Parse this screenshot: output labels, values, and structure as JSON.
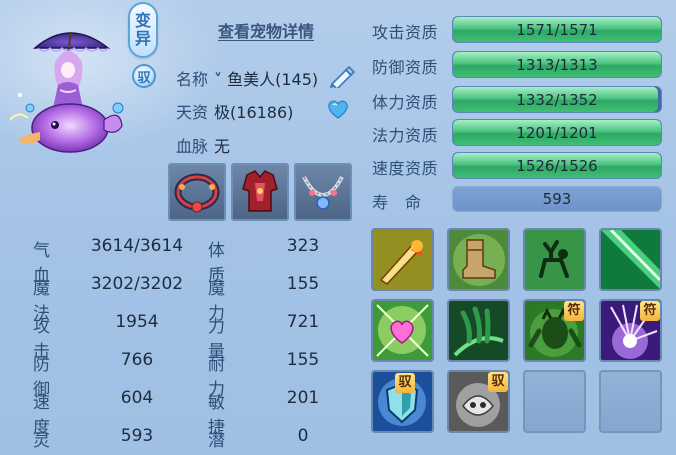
{
  "header": {
    "badge_top": "变",
    "badge_bottom": "异",
    "ride_badge": "驭",
    "detail_link": "查看宠物详情"
  },
  "pet": {
    "name_label": "名称",
    "name_value": "˅ 鱼美人(145)",
    "talent_label": "天资",
    "talent_value": "极(16186)",
    "blood_label": "血脉",
    "blood_value": "无"
  },
  "equipment": [
    {
      "name": "red-necklace"
    },
    {
      "name": "red-armor"
    },
    {
      "name": "silver-necklace"
    }
  ],
  "attributes": {
    "left": [
      {
        "label": "气血",
        "value": "3614/3614"
      },
      {
        "label": "魔法",
        "value": "3202/3202"
      },
      {
        "label": "攻击",
        "value": "1954"
      },
      {
        "label": "防御",
        "value": "766"
      },
      {
        "label": "速度",
        "value": "604"
      },
      {
        "label": "灵力",
        "value": "593"
      }
    ],
    "right": [
      {
        "label": "体质",
        "value": "323"
      },
      {
        "label": "魔力",
        "value": "155"
      },
      {
        "label": "力量",
        "value": "721"
      },
      {
        "label": "耐力",
        "value": "155"
      },
      {
        "label": "敏捷",
        "value": "201"
      },
      {
        "label": "潜力",
        "value": "0"
      }
    ]
  },
  "aptitudes": [
    {
      "label": "攻击资质",
      "value": "1571/1571",
      "fill": 1.0
    },
    {
      "label": "防御资质",
      "value": "1313/1313",
      "fill": 1.0
    },
    {
      "label": "体力资质",
      "value": "1332/1352",
      "fill": 0.985
    },
    {
      "label": "法力资质",
      "value": "1201/1201",
      "fill": 1.0
    },
    {
      "label": "速度资质",
      "value": "1526/1526",
      "fill": 1.0
    }
  ],
  "lifespan": {
    "label": "寿　命",
    "value": "593"
  },
  "skills": [
    {
      "icon": "fire-sword-icon"
    },
    {
      "icon": "boot-icon"
    },
    {
      "icon": "deer-icon"
    },
    {
      "icon": "green-slash-icon"
    },
    {
      "icon": "heart-sparkle-icon"
    },
    {
      "icon": "green-claw-icon"
    },
    {
      "icon": "green-demon-icon",
      "tag": "符"
    },
    {
      "icon": "purple-burst-icon",
      "tag": "符"
    },
    {
      "icon": "blue-shield-icon",
      "tag": "驭"
    },
    {
      "icon": "grey-skull-icon",
      "tag": "驭"
    },
    {
      "icon": "empty-slot"
    },
    {
      "icon": "empty-slot"
    }
  ],
  "colors": {
    "accent_green": "#3fbf74",
    "bar_bg": "#3f6aa3",
    "panel_bg": "#a3c2e6"
  }
}
